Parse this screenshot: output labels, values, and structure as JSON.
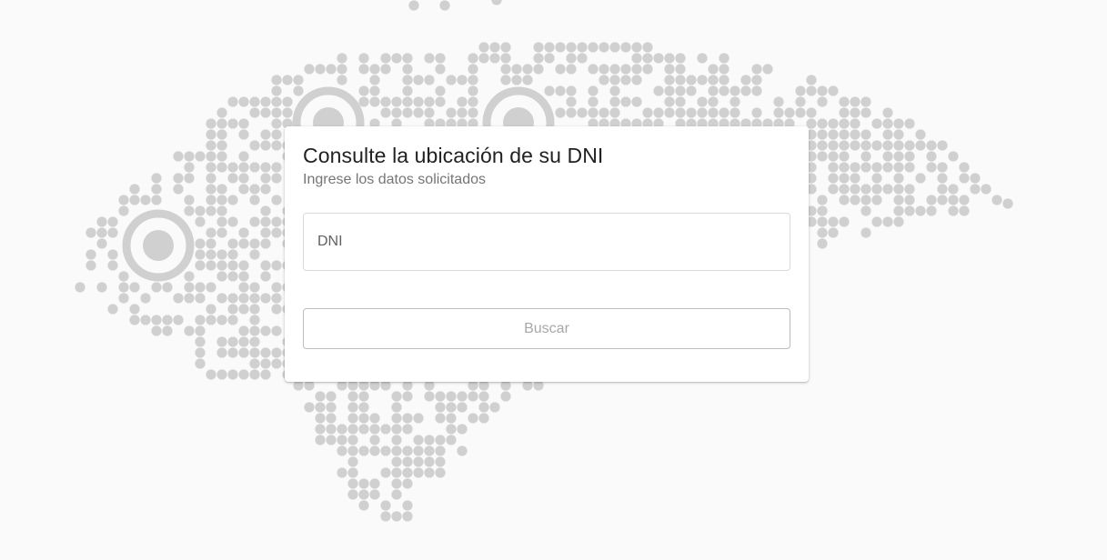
{
  "background": {
    "color": "#fafafa",
    "dot_color": "#d0d0d0"
  },
  "form": {
    "title": "Consulte la ubicación de su DNI",
    "subtitle": "Ingrese los datos solicitados",
    "dni_field": {
      "placeholder": "DNI",
      "value": ""
    },
    "search_button_label": "Buscar",
    "search_button_enabled": false
  }
}
